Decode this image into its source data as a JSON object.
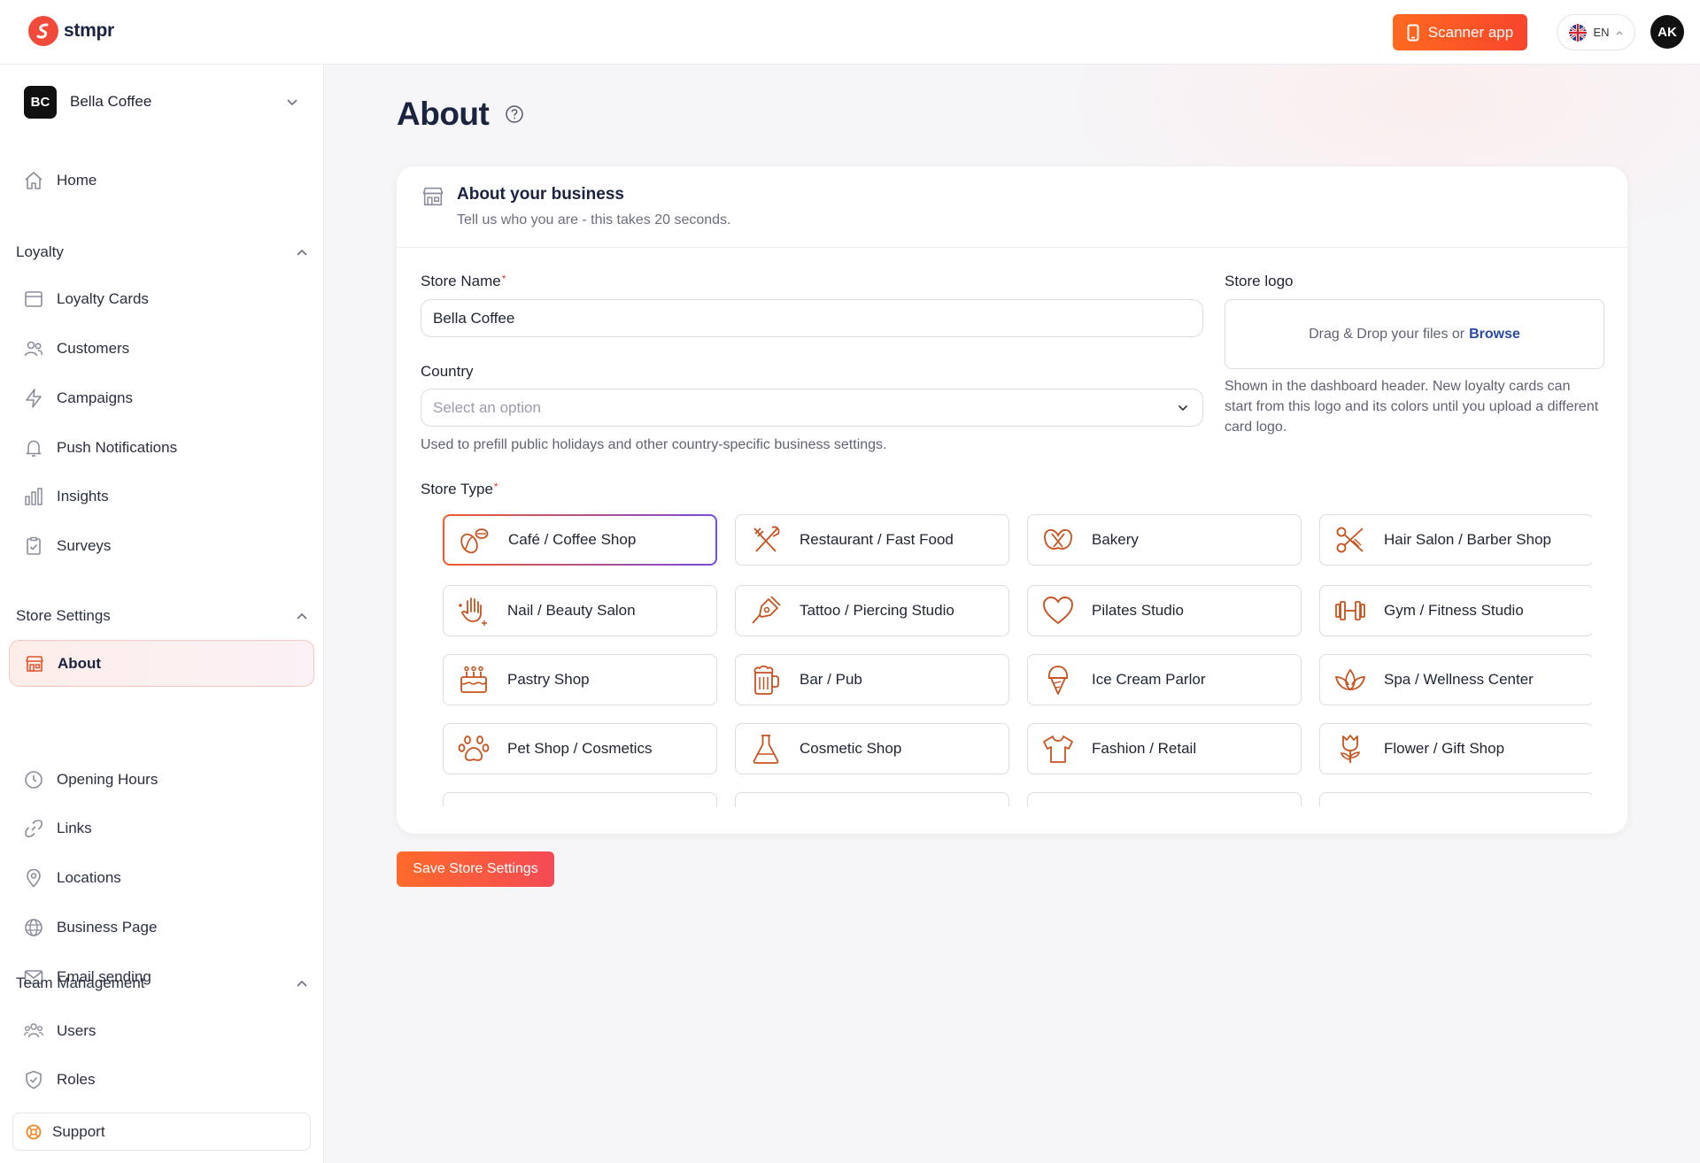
{
  "app": {
    "name": "stmpr"
  },
  "topbar": {
    "scanner_label": "Scanner app",
    "lang": "EN",
    "user_initials": "AK"
  },
  "business": {
    "initials": "BC",
    "name": "Bella Coffee"
  },
  "nav": {
    "home": "Home",
    "loyalty_label": "Loyalty",
    "loyalty": [
      "Loyalty Cards",
      "Customers",
      "Campaigns",
      "Push Notifications",
      "Insights",
      "Surveys"
    ],
    "store_label": "Store Settings",
    "store": [
      "About",
      "Opening Hours",
      "Links",
      "Locations",
      "Business Page",
      "Email sending"
    ],
    "team_label": "Team Management",
    "team": [
      "Users",
      "Roles"
    ],
    "support": "Support"
  },
  "page": {
    "title": "About"
  },
  "card": {
    "title": "About your business",
    "subtitle": "Tell us who you are - this takes 20 seconds.",
    "store_name_label": "Store Name",
    "store_name_value": "Bella Coffee",
    "country_label": "Country",
    "country_placeholder": "Select an option",
    "country_hint": "Used to prefill public holidays and other country-specific business settings.",
    "logo_label": "Store logo",
    "logo_drop_text": "Drag & Drop your files or",
    "logo_browse": "Browse",
    "logo_hint": "Shown in the dashboard header. New loyalty cards can start from this logo and its colors until you upload a different card logo.",
    "store_type_label": "Store Type",
    "selected_type": "Café / Coffee Shop",
    "types": [
      "Café / Coffee Shop",
      "Restaurant / Fast Food",
      "Bakery",
      "Hair Salon / Barber Shop",
      "Nail / Beauty Salon",
      "Tattoo / Piercing Studio",
      "Pilates Studio",
      "Gym / Fitness Studio",
      "Pastry Shop",
      "Bar / Pub",
      "Ice Cream Parlor",
      "Spa / Wellness Center",
      "Pet Shop / Cosmetics",
      "Cosmetic Shop",
      "Fashion / Retail",
      "Flower / Gift Shop"
    ]
  },
  "save_label": "Save Store Settings",
  "colors": {
    "accent": "#f15a24",
    "icon": "#c8521e",
    "navy": "#1a2340"
  }
}
